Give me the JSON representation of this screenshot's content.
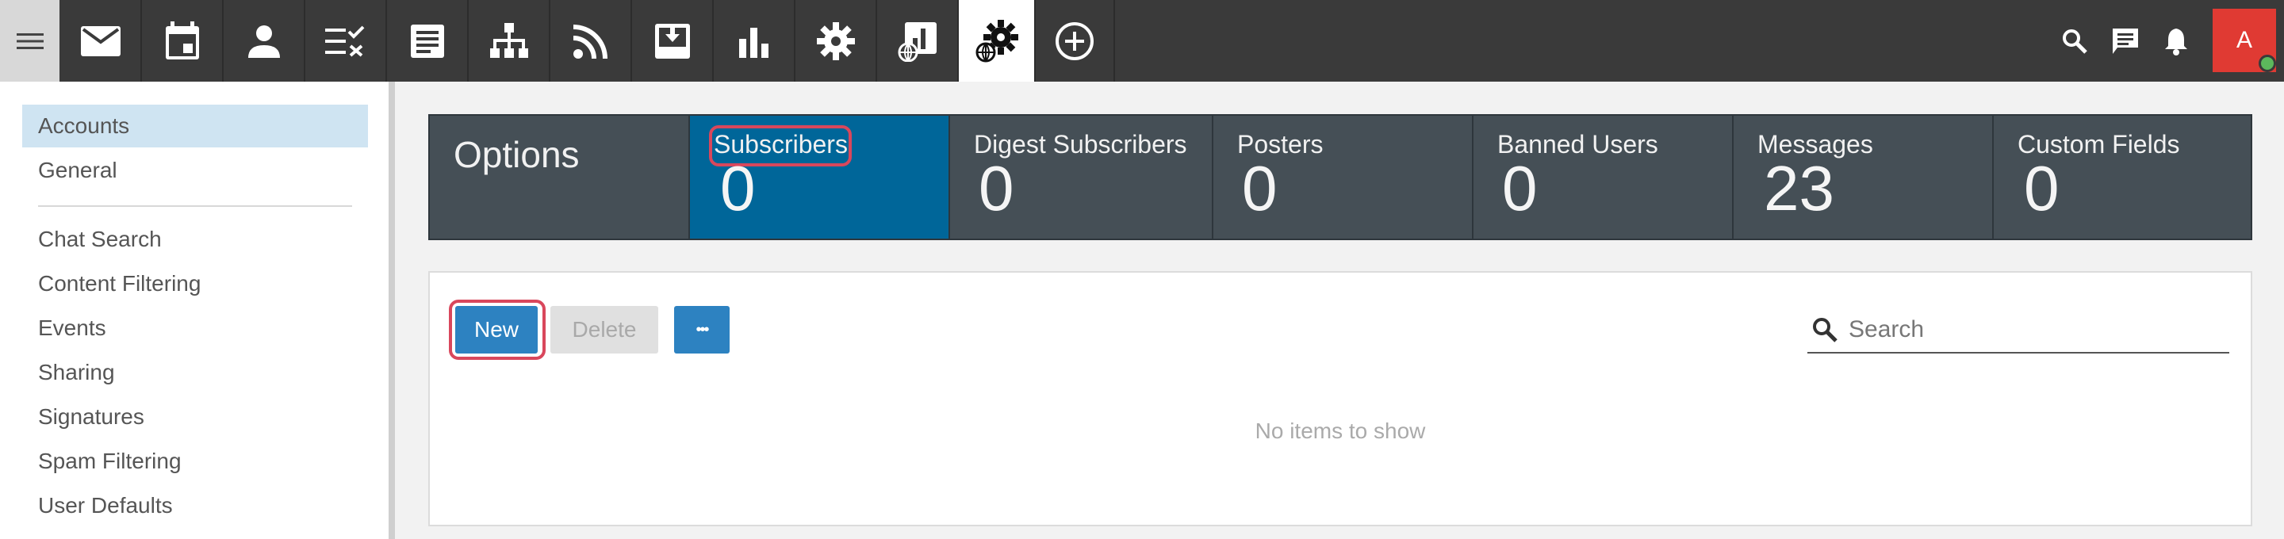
{
  "topbar": {
    "icons": [
      "menu-icon",
      "mail-icon",
      "calendar-icon",
      "contacts-icon",
      "tasks-icon",
      "notes-icon",
      "org-chart-icon",
      "rss-icon",
      "inbox-download-icon",
      "reports-icon",
      "settings-icon",
      "domain-reports-icon",
      "domain-settings-icon",
      "add-icon"
    ],
    "right_icons": [
      "search-icon",
      "chat-icon",
      "bell-icon"
    ],
    "avatar_letter": "A",
    "avatar_color": "#e03a33",
    "status": "online"
  },
  "sidebar": {
    "items_top": [
      "Accounts",
      "General"
    ],
    "items_bottom": [
      "Chat Search",
      "Content Filtering",
      "Events",
      "Sharing",
      "Signatures",
      "Spam Filtering",
      "User Defaults"
    ],
    "active": "Accounts"
  },
  "stats": {
    "title": "Options",
    "items": [
      {
        "label": "Subscribers",
        "value": "0"
      },
      {
        "label": "Digest Subscribers",
        "value": "0"
      },
      {
        "label": "Posters",
        "value": "0"
      },
      {
        "label": "Banned Users",
        "value": "0"
      },
      {
        "label": "Messages",
        "value": "23"
      },
      {
        "label": "Custom Fields",
        "value": "0"
      }
    ],
    "active": "Subscribers",
    "active_color": "#006699"
  },
  "toolbar": {
    "new_label": "New",
    "delete_label": "Delete",
    "more_label": "•••"
  },
  "search": {
    "placeholder": "Search",
    "value": ""
  },
  "list": {
    "empty_message": "No items to show"
  },
  "colors": {
    "accent": "#2d82c1",
    "highlight": "#d9475c"
  }
}
